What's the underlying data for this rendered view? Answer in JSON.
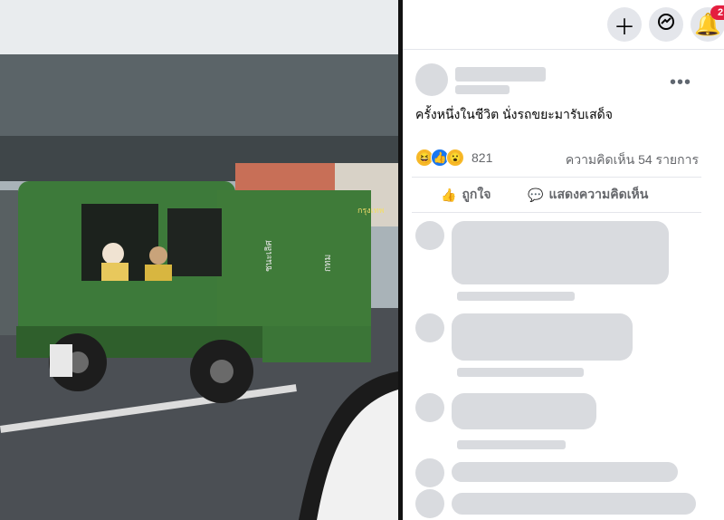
{
  "photo": {
    "alt": "",
    "truck_texts": [
      "ชนะเลิศ",
      "กทม",
      "กรุงเทพ"
    ]
  },
  "topbar": {
    "create_icon": "plus-icon",
    "messenger_icon": "messenger-icon",
    "notifications_icon": "bell-icon",
    "notifications_count": "2"
  },
  "post": {
    "author": "",
    "more_label": "•••",
    "text": "ครั้งหนึ่งในชีวิต นั่งรถขยะมารับเสด็จ",
    "reactions_count": "821",
    "comments_summary": "ความคิดเห็น 54 รายการ",
    "like_label": "ถูกใจ",
    "comment_label": "แสดงความคิดเห็น"
  },
  "colors": {
    "truck_green": "#3d7a3a",
    "badge_red": "#e41e3f"
  }
}
